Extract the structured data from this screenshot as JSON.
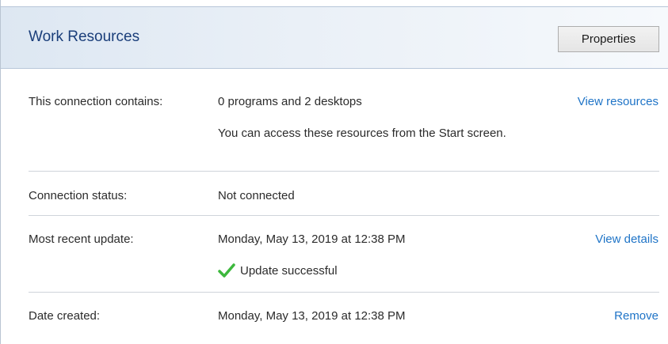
{
  "header": {
    "title": "Work Resources",
    "properties_label": "Properties"
  },
  "rows": {
    "contains": {
      "label": "This connection contains:",
      "value": "0 programs and 2 desktops",
      "note": "You can access these resources from the Start screen.",
      "link": "View resources"
    },
    "status": {
      "label": "Connection status:",
      "value": "Not connected"
    },
    "update": {
      "label": "Most recent update:",
      "value": "Monday, May 13, 2019 at 12:38 PM",
      "result": "Update successful",
      "link": "View details"
    },
    "created": {
      "label": "Date created:",
      "value": "Monday, May 13, 2019 at 12:38 PM",
      "link": "Remove"
    }
  },
  "icons": {
    "success": "checkmark-icon"
  },
  "colors": {
    "title": "#1a3e7a",
    "link": "#1f74c7",
    "success": "#3db83d"
  }
}
